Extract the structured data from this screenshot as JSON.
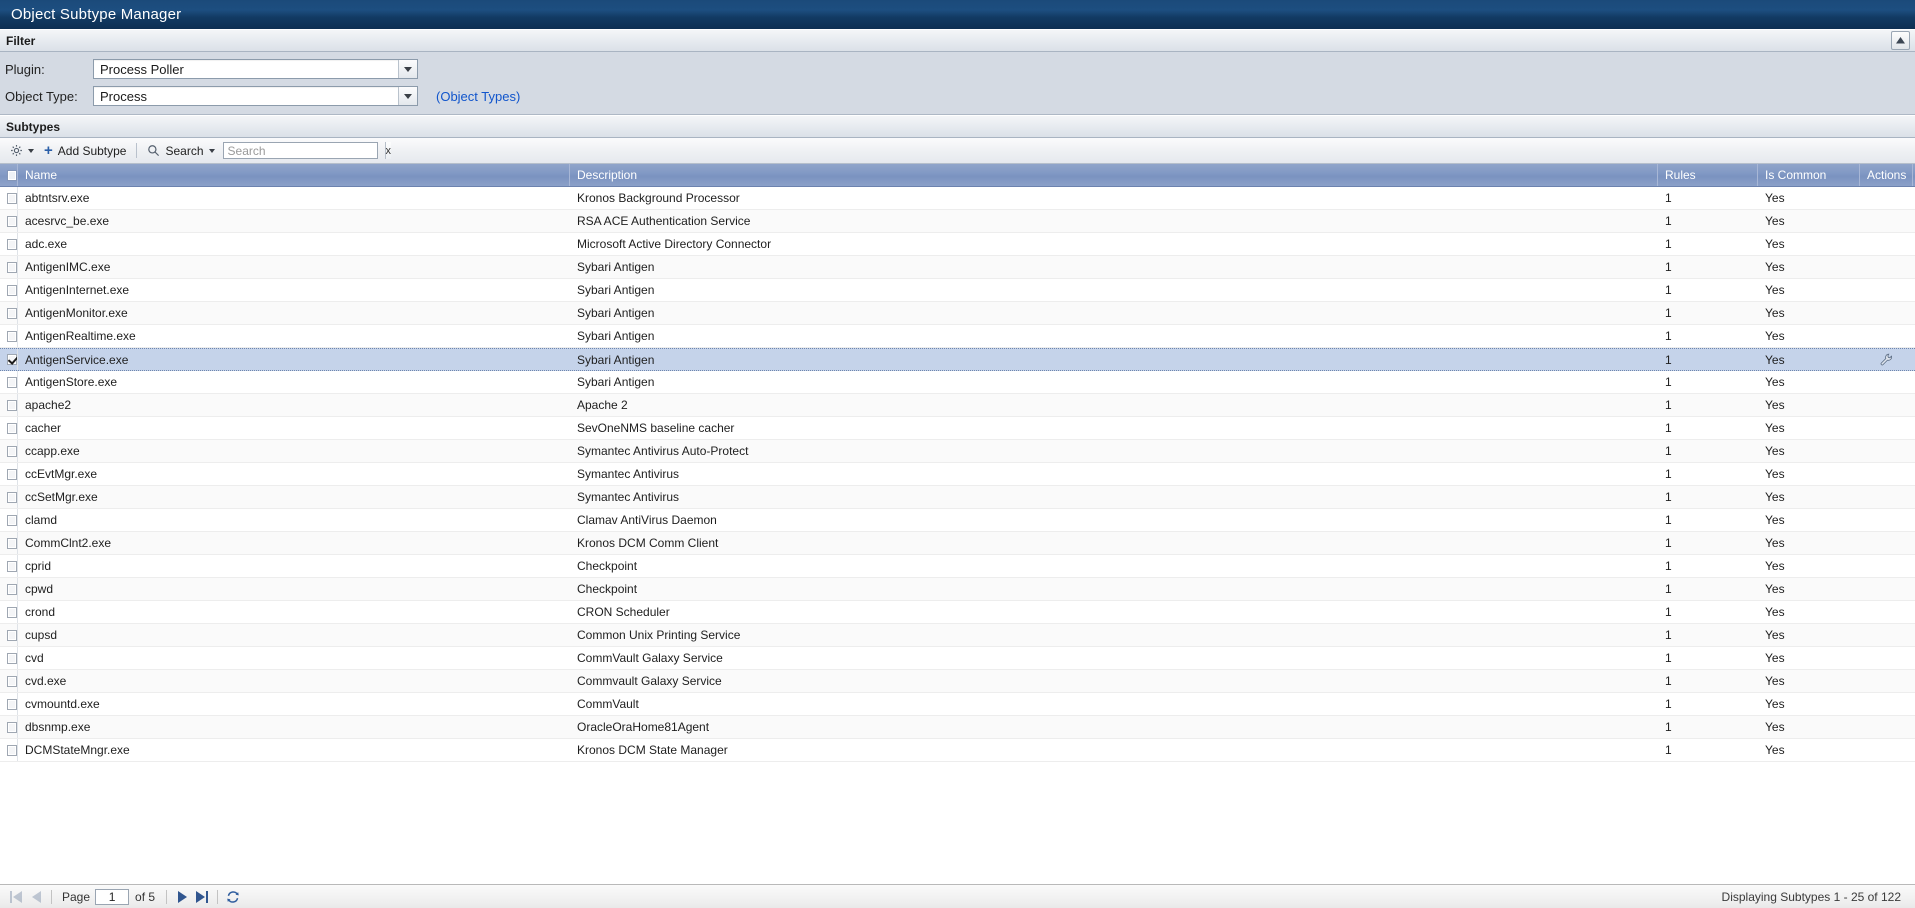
{
  "window": {
    "title": "Object Subtype Manager"
  },
  "filter": {
    "section_label": "Filter",
    "collapse_icon": "collapse-up-icon",
    "plugin_label": "Plugin:",
    "plugin_value": "Process Poller",
    "object_type_label": "Object Type:",
    "object_type_value": "Process",
    "object_types_link": "(Object Types)"
  },
  "subtypes": {
    "section_label": "Subtypes",
    "toolbar": {
      "gear_icon": "gear-icon",
      "add_label": "Add Subtype",
      "search_label": "Search",
      "search_icon": "magnifier-icon",
      "search_value": "",
      "search_placeholder": "Search",
      "clear_label": "x"
    },
    "columns": [
      "Name",
      "Description",
      "Rules",
      "Is Common",
      "Actions"
    ],
    "action_icon": "wrench-icon",
    "rows": [
      {
        "name": "abtntsrv.exe",
        "description": "Kronos Background Processor",
        "rules": "1",
        "common": "Yes",
        "selected": false
      },
      {
        "name": "acesrvc_be.exe",
        "description": "RSA ACE Authentication Service",
        "rules": "1",
        "common": "Yes",
        "selected": false
      },
      {
        "name": "adc.exe",
        "description": "Microsoft Active Directory Connector",
        "rules": "1",
        "common": "Yes",
        "selected": false
      },
      {
        "name": "AntigenIMC.exe",
        "description": "Sybari Antigen",
        "rules": "1",
        "common": "Yes",
        "selected": false
      },
      {
        "name": "AntigenInternet.exe",
        "description": "Sybari Antigen",
        "rules": "1",
        "common": "Yes",
        "selected": false
      },
      {
        "name": "AntigenMonitor.exe",
        "description": "Sybari Antigen",
        "rules": "1",
        "common": "Yes",
        "selected": false
      },
      {
        "name": "AntigenRealtime.exe",
        "description": "Sybari Antigen",
        "rules": "1",
        "common": "Yes",
        "selected": false
      },
      {
        "name": "AntigenService.exe",
        "description": "Sybari Antigen",
        "rules": "1",
        "common": "Yes",
        "selected": true
      },
      {
        "name": "AntigenStore.exe",
        "description": "Sybari Antigen",
        "rules": "1",
        "common": "Yes",
        "selected": false
      },
      {
        "name": "apache2",
        "description": "Apache 2",
        "rules": "1",
        "common": "Yes",
        "selected": false
      },
      {
        "name": "cacher",
        "description": "SevOneNMS baseline cacher",
        "rules": "1",
        "common": "Yes",
        "selected": false
      },
      {
        "name": "ccapp.exe",
        "description": "Symantec Antivirus Auto-Protect",
        "rules": "1",
        "common": "Yes",
        "selected": false
      },
      {
        "name": "ccEvtMgr.exe",
        "description": "Symantec Antivirus",
        "rules": "1",
        "common": "Yes",
        "selected": false
      },
      {
        "name": "ccSetMgr.exe",
        "description": "Symantec Antivirus",
        "rules": "1",
        "common": "Yes",
        "selected": false
      },
      {
        "name": "clamd",
        "description": "Clamav AntiVirus Daemon",
        "rules": "1",
        "common": "Yes",
        "selected": false
      },
      {
        "name": "CommClnt2.exe",
        "description": "Kronos DCM Comm Client",
        "rules": "1",
        "common": "Yes",
        "selected": false
      },
      {
        "name": "cprid",
        "description": "Checkpoint",
        "rules": "1",
        "common": "Yes",
        "selected": false
      },
      {
        "name": "cpwd",
        "description": "Checkpoint",
        "rules": "1",
        "common": "Yes",
        "selected": false
      },
      {
        "name": "crond",
        "description": "CRON Scheduler",
        "rules": "1",
        "common": "Yes",
        "selected": false
      },
      {
        "name": "cupsd",
        "description": "Common Unix Printing Service",
        "rules": "1",
        "common": "Yes",
        "selected": false
      },
      {
        "name": "cvd",
        "description": "CommVault Galaxy Service",
        "rules": "1",
        "common": "Yes",
        "selected": false
      },
      {
        "name": "cvd.exe",
        "description": "Commvault Galaxy Service",
        "rules": "1",
        "common": "Yes",
        "selected": false
      },
      {
        "name": "cvmountd.exe",
        "description": "CommVault",
        "rules": "1",
        "common": "Yes",
        "selected": false
      },
      {
        "name": "dbsnmp.exe",
        "description": "OracleOraHome81Agent",
        "rules": "1",
        "common": "Yes",
        "selected": false
      },
      {
        "name": "DCMStateMngr.exe",
        "description": "Kronos DCM State Manager",
        "rules": "1",
        "common": "Yes",
        "selected": false
      }
    ]
  },
  "footer": {
    "first_icon": "first-page-icon",
    "prev_icon": "previous-page-icon",
    "page_label": "Page",
    "page_value": "1",
    "of_label": "of 5",
    "next_icon": "next-page-icon",
    "last_icon": "last-page-icon",
    "refresh_icon": "refresh-icon",
    "status": "Displaying Subtypes 1 - 25 of 122"
  },
  "colors": {
    "title_bar": "#123a63",
    "grid_header": "#8098c4",
    "selected_row": "#c5d3ea",
    "link": "#1155cc",
    "filter_bg": "#d4dae3"
  }
}
